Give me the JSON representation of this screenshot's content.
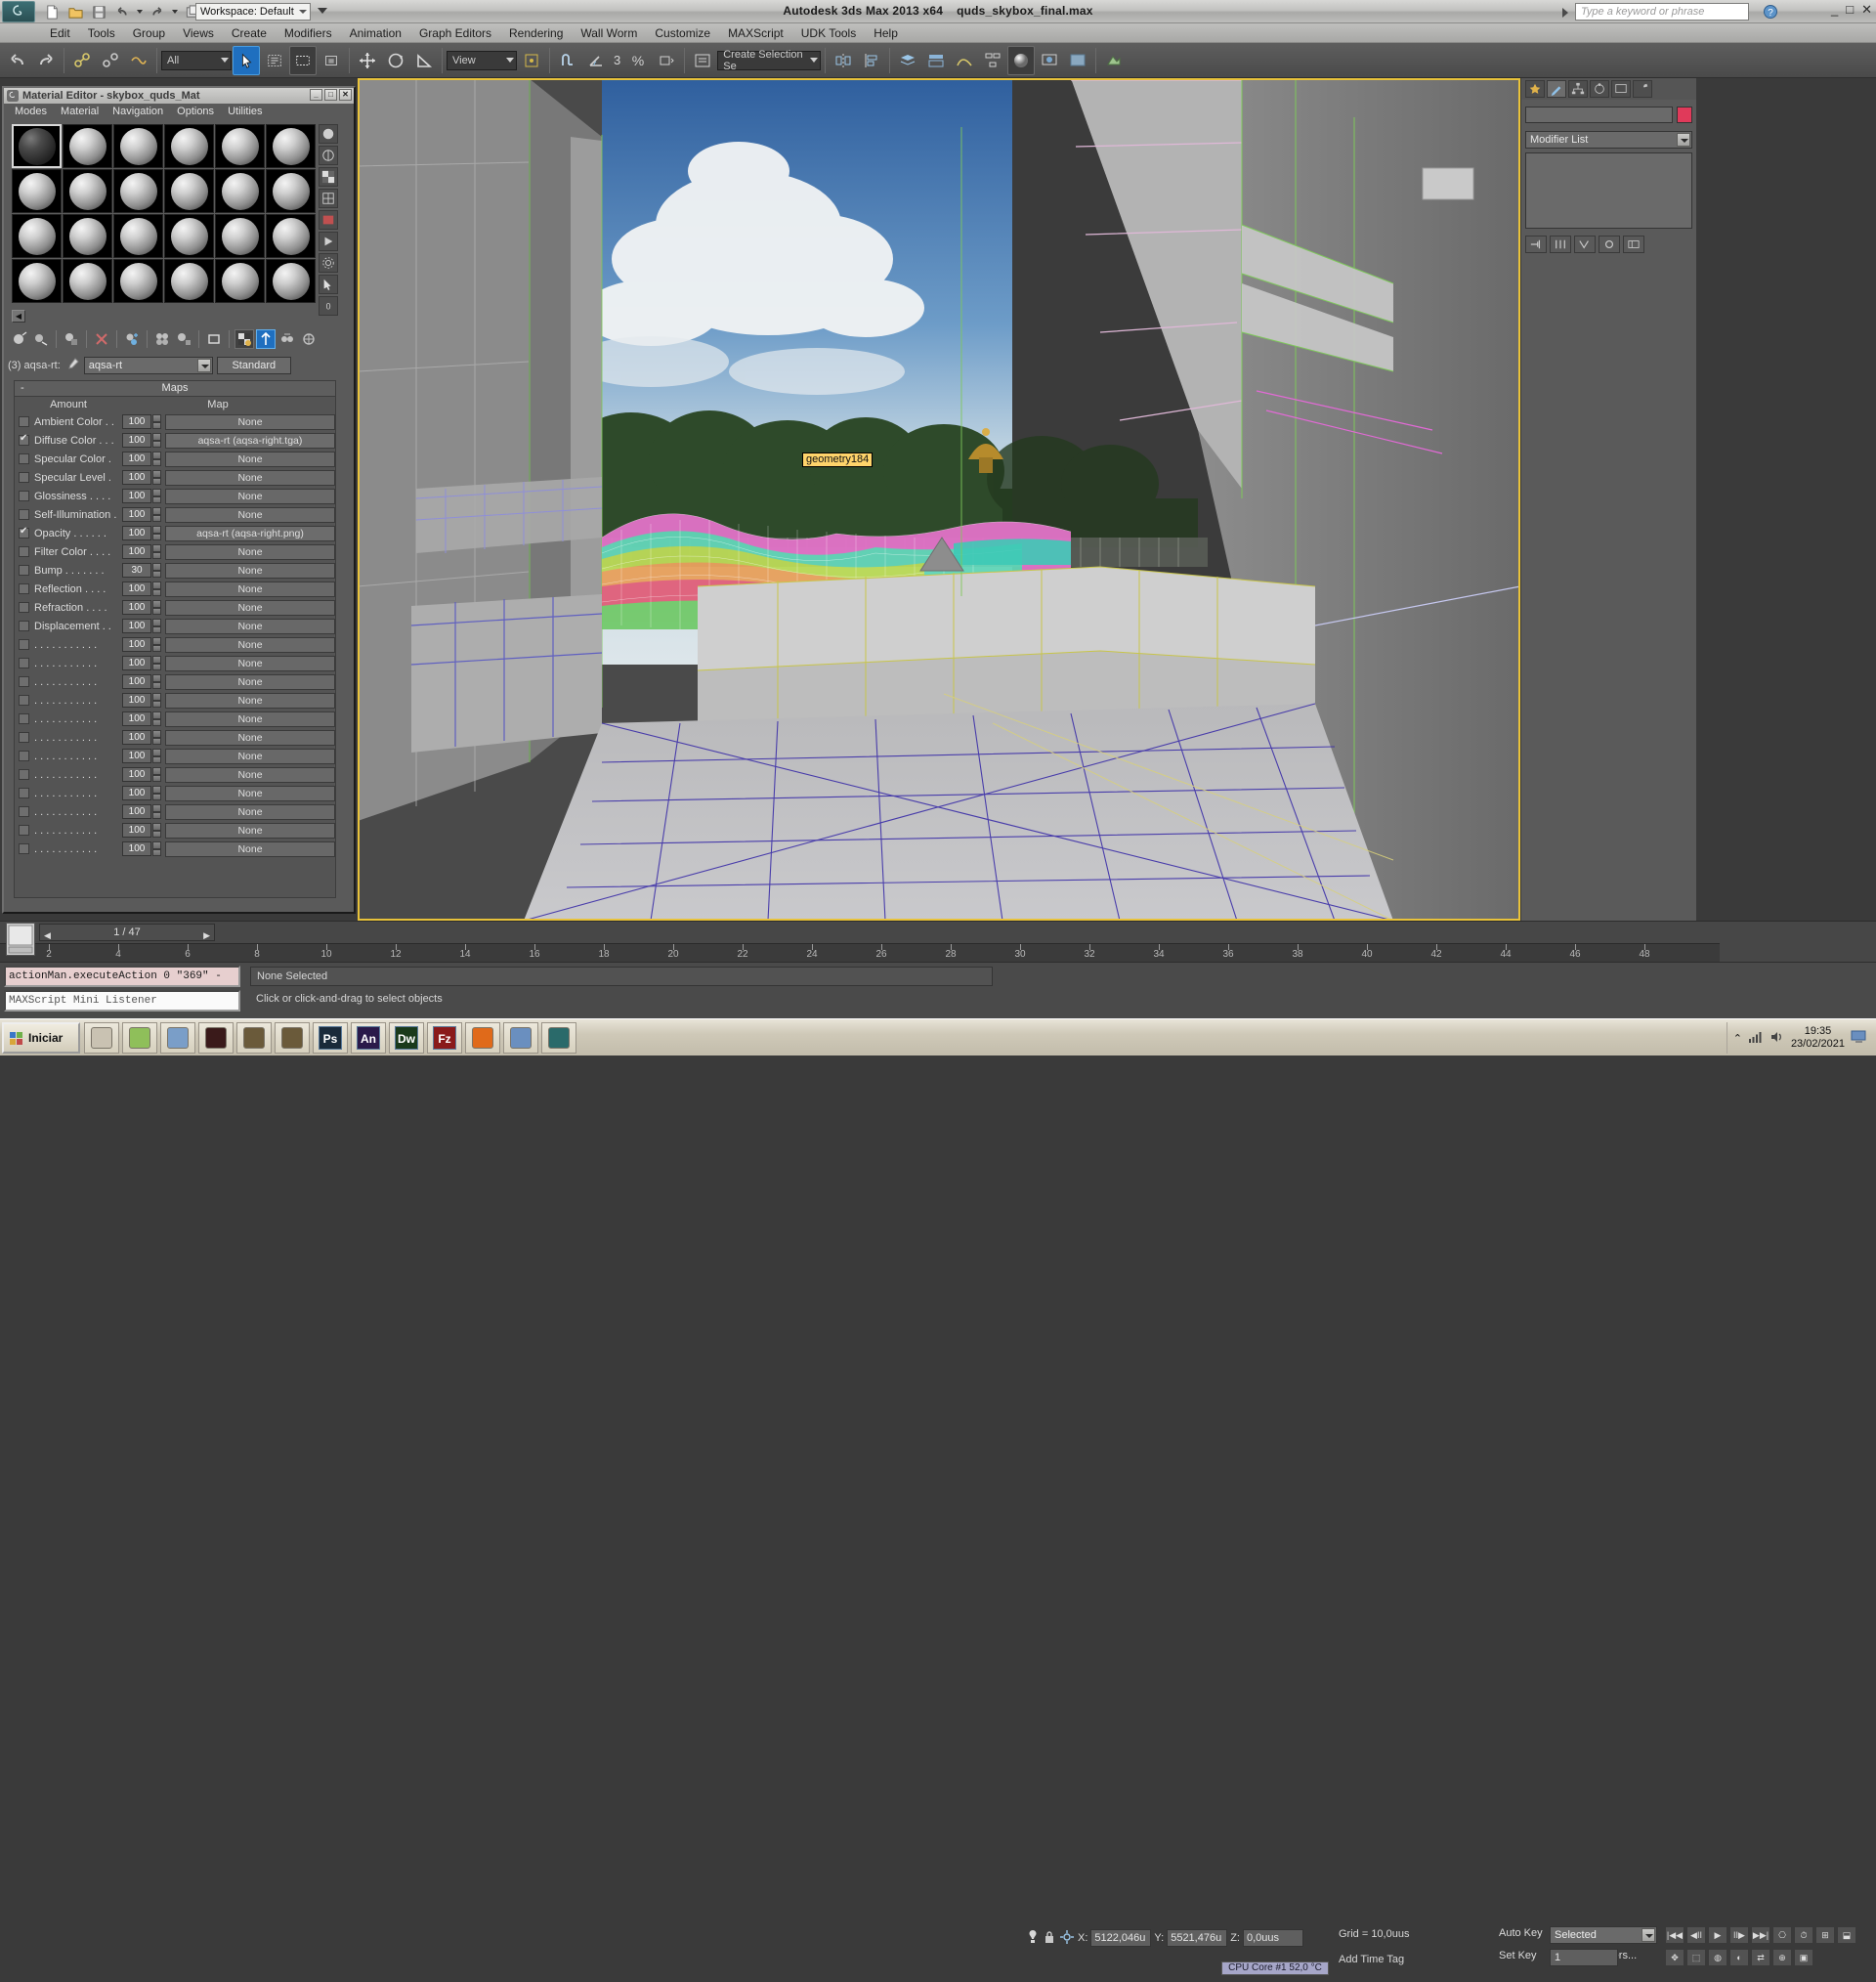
{
  "titlebar": {
    "app_title": "Autodesk 3ds Max  2013 x64",
    "file_name": "quds_skybox_final.max",
    "workspace": "Workspace: Default",
    "search_placeholder": "Type a keyword or phrase",
    "minimize": "_",
    "maximize": "□",
    "close": "✕"
  },
  "menubar": {
    "items": [
      "Edit",
      "Tools",
      "Group",
      "Views",
      "Create",
      "Modifiers",
      "Animation",
      "Graph Editors",
      "Rendering",
      "Wall Worm",
      "Customize",
      "MAXScript",
      "UDK Tools",
      "Help"
    ]
  },
  "maintoolbar": {
    "select_filter": "All",
    "reference_coord": "View",
    "named_selection": "Create Selection Se",
    "percent_symbol": "%",
    "angle_snap_value": "3"
  },
  "material_editor": {
    "title": "Material Editor - skybox_quds_Mat",
    "menus": [
      "Modes",
      "Material",
      "Navigation",
      "Options",
      "Utilities"
    ],
    "slot_count": 24,
    "selected_slot_index": 0,
    "material_index_label": "(3) aqsa-rt:",
    "material_name": "aqsa-rt",
    "material_type": "Standard",
    "rollout_title": "Maps",
    "col_amount": "Amount",
    "col_map": "Map",
    "rows": [
      {
        "name": "Ambient Color . .",
        "checked": false,
        "amount": "100",
        "map": "None"
      },
      {
        "name": "Diffuse Color . . .",
        "checked": true,
        "amount": "100",
        "map": "aqsa-rt (aqsa-right.tga)"
      },
      {
        "name": "Specular Color  .",
        "checked": false,
        "amount": "100",
        "map": "None"
      },
      {
        "name": "Specular Level  .",
        "checked": false,
        "amount": "100",
        "map": "None"
      },
      {
        "name": "Glossiness  . . . .",
        "checked": false,
        "amount": "100",
        "map": "None"
      },
      {
        "name": "Self-Illumination .",
        "checked": false,
        "amount": "100",
        "map": "None"
      },
      {
        "name": "Opacity . . . . . .",
        "checked": true,
        "amount": "100",
        "map": "aqsa-rt (aqsa-right.png)"
      },
      {
        "name": "Filter Color . . . .",
        "checked": false,
        "amount": "100",
        "map": "None"
      },
      {
        "name": "Bump  . . . . . . .",
        "checked": false,
        "amount": "30",
        "map": "None"
      },
      {
        "name": "Reflection . . . .",
        "checked": false,
        "amount": "100",
        "map": "None"
      },
      {
        "name": "Refraction . . . .",
        "checked": false,
        "amount": "100",
        "map": "None"
      },
      {
        "name": "Displacement . .",
        "checked": false,
        "amount": "100",
        "map": "None"
      },
      {
        "name": ". . . . . . . . . . .",
        "checked": false,
        "amount": "100",
        "map": "None"
      },
      {
        "name": ". . . . . . . . . . .",
        "checked": false,
        "amount": "100",
        "map": "None"
      },
      {
        "name": ". . . . . . . . . . .",
        "checked": false,
        "amount": "100",
        "map": "None"
      },
      {
        "name": ". . . . . . . . . . .",
        "checked": false,
        "amount": "100",
        "map": "None"
      },
      {
        "name": ". . . . . . . . . . .",
        "checked": false,
        "amount": "100",
        "map": "None"
      },
      {
        "name": ". . . . . . . . . . .",
        "checked": false,
        "amount": "100",
        "map": "None"
      },
      {
        "name": ". . . . . . . . . . .",
        "checked": false,
        "amount": "100",
        "map": "None"
      },
      {
        "name": ". . . . . . . . . . .",
        "checked": false,
        "amount": "100",
        "map": "None"
      },
      {
        "name": ". . . . . . . . . . .",
        "checked": false,
        "amount": "100",
        "map": "None"
      },
      {
        "name": ". . . . . . . . . . .",
        "checked": false,
        "amount": "100",
        "map": "None"
      },
      {
        "name": ". . . . . . . . . . .",
        "checked": false,
        "amount": "100",
        "map": "None"
      },
      {
        "name": ". . . . . . . . . . .",
        "checked": false,
        "amount": "100",
        "map": "None"
      }
    ]
  },
  "viewport": {
    "object_tooltip": "geometry184"
  },
  "command_panel": {
    "object_name": "",
    "modifier_list": "Modifier List",
    "accent_color": "#e03a5a"
  },
  "timeline": {
    "frame_indicator": "1 / 47",
    "ticks": [
      "2",
      "4",
      "6",
      "8",
      "10",
      "12",
      "14",
      "16",
      "18",
      "20",
      "22",
      "24",
      "26",
      "28",
      "30",
      "32",
      "34",
      "36",
      "38",
      "40",
      "42",
      "44",
      "46",
      "48"
    ]
  },
  "statusbar": {
    "listener_line": "actionMan.executeAction 0 \"369\"  -",
    "listener_hint": "MAXScript Mini Listener",
    "selection_text": "None Selected",
    "hint_text": "Click or click-and-drag to select objects",
    "coord_x_label": "X:",
    "coord_x": "5122,046u",
    "coord_y_label": "Y:",
    "coord_y": "5521,476u",
    "coord_z_label": "Z:",
    "coord_z": "0,0uus",
    "grid_text": "Grid = 10,0uus",
    "add_time_tag": "Add Time Tag",
    "cpu_text": "CPU Core #1    52,0 °C",
    "auto_key": "Auto Key",
    "set_key": "Set Key",
    "key_filters": "Key Filters...",
    "selected_dd": "Selected",
    "frame_field": "1"
  },
  "taskbar": {
    "start_label": "Iniciar",
    "items": [
      "wings3d-icon",
      "notepadpp-icon",
      "hammer-icon",
      "unreal-icon",
      "tool-shield-icon",
      "tool-shield2-icon",
      "photoshop-icon",
      "animate-icon",
      "dreamweaver-icon",
      "filezilla-icon",
      "firefox-icon",
      "explorer-icon",
      "3dsmax-icon"
    ],
    "app_labels": [
      "",
      "",
      "",
      "",
      "",
      "",
      "Ps",
      "An",
      "Dw",
      "Fz",
      "",
      "",
      ""
    ],
    "clock_time": "19:35",
    "clock_date": "23/02/2021"
  }
}
